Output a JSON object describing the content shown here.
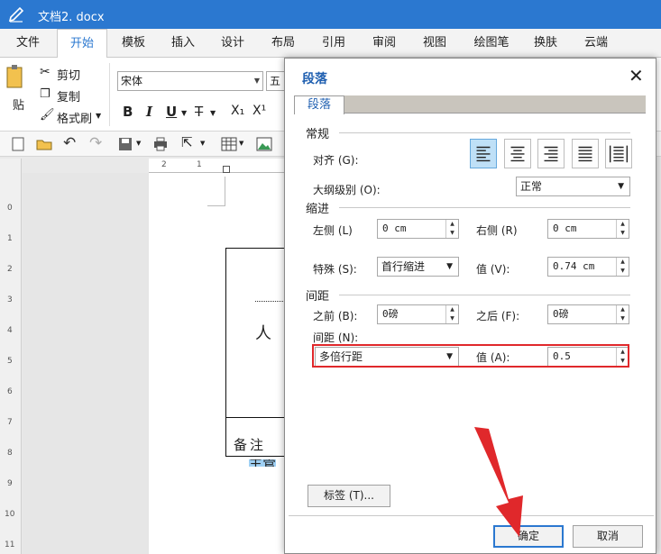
{
  "window": {
    "title": "文档2. docx"
  },
  "menu_tabs": [
    "文件",
    "开始",
    "模板",
    "插入",
    "设计",
    "布局",
    "引用",
    "审阅",
    "视图",
    "绘图笔",
    "换肤",
    "云端"
  ],
  "ribbon": {
    "paste": "贴",
    "cut": "剪切",
    "copy": "复制",
    "format_painter": "格式刷",
    "font_name": "宋体",
    "font_size": "五号",
    "bold": "B",
    "italic": "I",
    "underline": "U",
    "strike": "T",
    "subscript": "X₁",
    "superscript": "X¹"
  },
  "ruler": {
    "h_ticks": [
      "2",
      "1"
    ],
    "v_ticks": [
      "0",
      "1",
      "2",
      "3",
      "4",
      "5",
      "6",
      "7",
      "8",
      "9",
      "10",
      "11"
    ]
  },
  "document": {
    "char_person": "人",
    "note_text": "备注",
    "selected_text": "主管"
  },
  "dialog": {
    "title": "段落",
    "tab": "段落",
    "sections": {
      "general": "常规",
      "indent": "缩进",
      "spacing": "间距"
    },
    "alignment_label": "对齐 (G):",
    "outline_label": "大纲级别 (O):",
    "outline_value": "正常",
    "left_label": "左侧 (L)",
    "left_value": "0 cm",
    "right_label": "右侧 (R)",
    "right_value": "0 cm",
    "special_label": "特殊 (S):",
    "special_value": "首行缩进",
    "value_v_label": "值 (V):",
    "value_v": "0.74 cm",
    "before_label": "之前 (B):",
    "before_value": "0磅",
    "after_label": "之后 (F):",
    "after_value": "0磅",
    "line_spacing_label": "间距 (N):",
    "line_spacing_value": "多倍行距",
    "value_a_label": "值 (A):",
    "value_a": "0.5",
    "tabs_button": "标签 (T)...",
    "ok_button": "确定",
    "cancel_button": "取消"
  },
  "colors": {
    "accent": "#2b78d0",
    "highlight": "#e0282b"
  }
}
